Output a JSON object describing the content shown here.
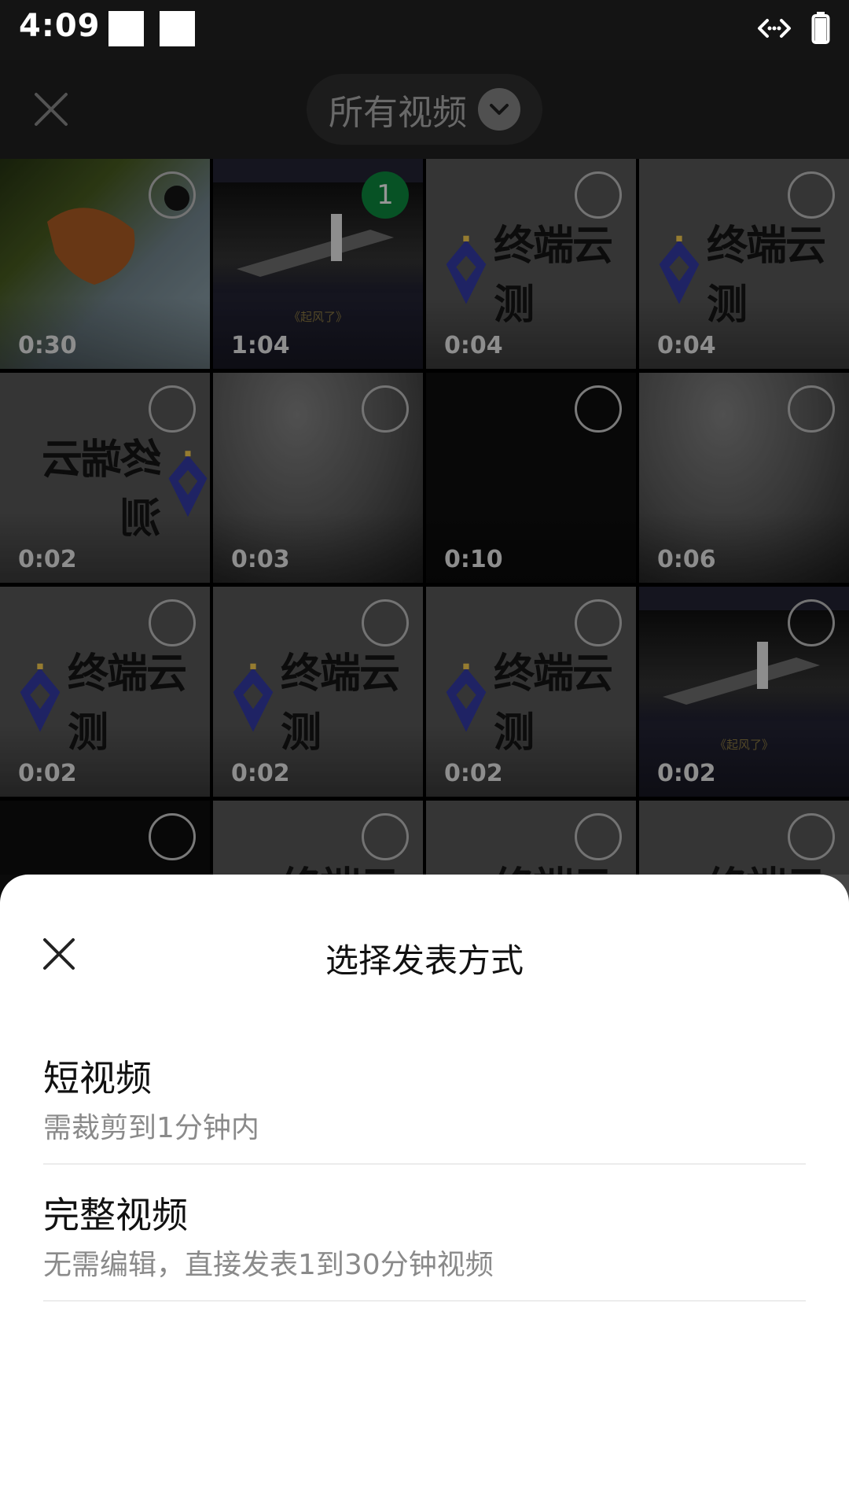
{
  "status_bar": {
    "time": "4:09"
  },
  "header": {
    "album_label": "所有视频"
  },
  "grid": {
    "items": [
      {
        "duration": "0:30",
        "thumb": "duck",
        "selected": false
      },
      {
        "duration": "1:04",
        "thumb": "stage",
        "selected": true,
        "order": "1"
      },
      {
        "duration": "0:04",
        "thumb": "logo",
        "selected": false
      },
      {
        "duration": "0:04",
        "thumb": "logo",
        "selected": false
      },
      {
        "duration": "0:02",
        "thumb": "logo-mirror",
        "selected": false
      },
      {
        "duration": "0:03",
        "thumb": "blur",
        "selected": false
      },
      {
        "duration": "0:10",
        "thumb": "black",
        "selected": false
      },
      {
        "duration": "0:06",
        "thumb": "blur",
        "selected": false
      },
      {
        "duration": "0:02",
        "thumb": "logo",
        "selected": false
      },
      {
        "duration": "0:02",
        "thumb": "logo",
        "selected": false
      },
      {
        "duration": "0:02",
        "thumb": "logo",
        "selected": false
      },
      {
        "duration": "0:02",
        "thumb": "stage",
        "selected": false
      },
      {
        "duration": "",
        "thumb": "black",
        "selected": false
      },
      {
        "duration": "",
        "thumb": "logo",
        "selected": false
      },
      {
        "duration": "",
        "thumb": "logo",
        "selected": false
      },
      {
        "duration": "",
        "thumb": "logo",
        "selected": false
      }
    ],
    "logo_text": "终端云测",
    "stage_caption": "《起风了》"
  },
  "sheet": {
    "title": "选择发表方式",
    "options": [
      {
        "label": "短视频",
        "desc": "需裁剪到1分钟内"
      },
      {
        "label": "完整视频",
        "desc": "无需编辑，直接发表1到30分钟视频"
      }
    ]
  },
  "icons": {
    "close": "close-icon",
    "chevron": "chevron-down-icon",
    "select": "select-circle-icon",
    "battery": "battery-icon",
    "data": "data-transfer-icon"
  },
  "colors": {
    "selected_badge": "#07C160",
    "sheet_bg": "#FFFFFF"
  }
}
